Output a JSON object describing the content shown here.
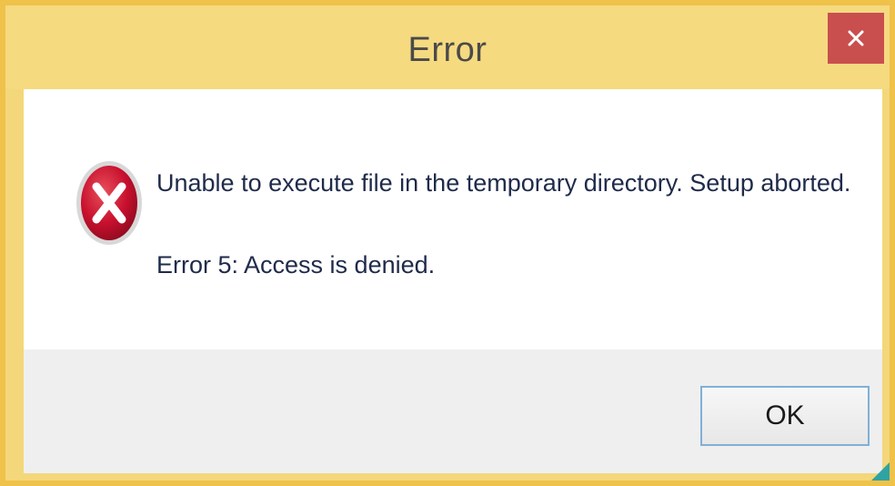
{
  "window": {
    "title": "Error"
  },
  "titlebar": {
    "close_icon": "close-icon"
  },
  "dialog": {
    "icon": "error-icon",
    "message": "Unable to execute file in the temporary directory. Setup aborted.",
    "detail": "Error 5: Access is denied."
  },
  "buttons": {
    "ok_label": "OK"
  },
  "colors": {
    "frame": "#efc24a",
    "titlebar": "#f5da80",
    "close_button": "#c94f4f",
    "error_red": "#c8102e",
    "ok_border": "#7fb0d8"
  }
}
